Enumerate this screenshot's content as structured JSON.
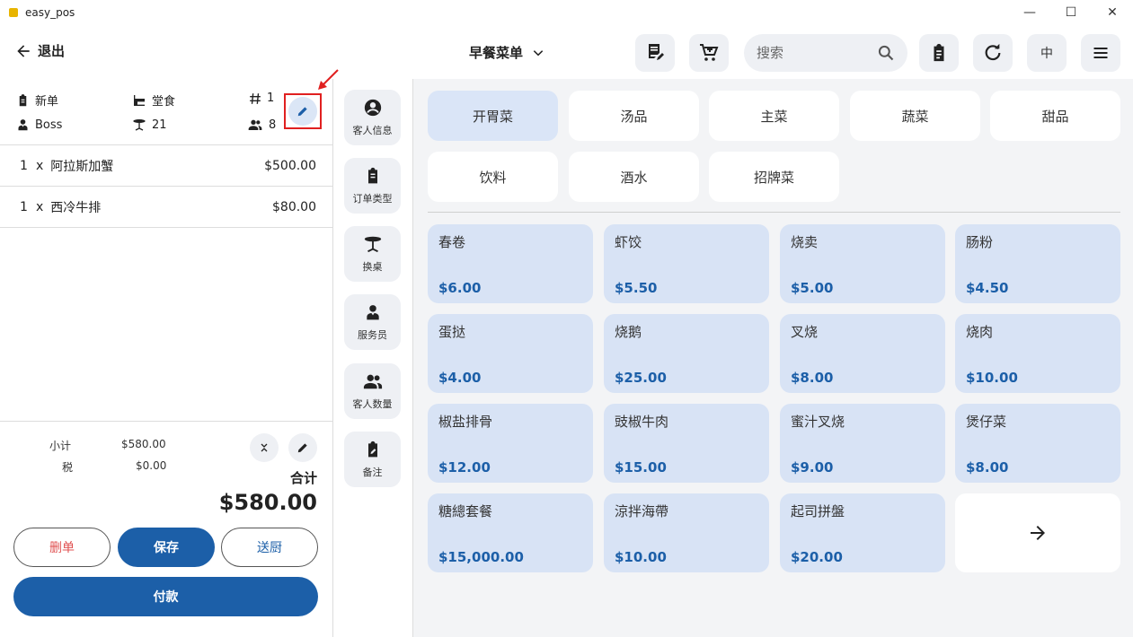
{
  "window": {
    "title": "easy_pos",
    "minimize": "—",
    "maximize": "☐",
    "close": "✕"
  },
  "header": {
    "back_label": "退出",
    "menu_name": "早餐菜单",
    "search_placeholder": "搜索",
    "language": "中"
  },
  "order": {
    "info": {
      "status": "新单",
      "dining_type": "堂食",
      "order_number": "1",
      "waiter": "Boss",
      "table": "21",
      "guests": "8"
    },
    "items": [
      {
        "qty": "1",
        "x": "x",
        "name": "阿拉斯加蟹",
        "price": "$500.00"
      },
      {
        "qty": "1",
        "x": "x",
        "name": "西冷牛排",
        "price": "$80.00"
      }
    ],
    "subtotal_label": "小计",
    "subtotal_value": "$580.00",
    "tax_label": "税",
    "tax_value": "$0.00",
    "total_label": "合计",
    "total_value": "$580.00",
    "buttons": {
      "delete": "删单",
      "save": "保存",
      "kitchen": "送厨",
      "pay": "付款"
    }
  },
  "side_actions": [
    {
      "label": "客人信息",
      "icon": "account-circle-icon"
    },
    {
      "label": "订单类型",
      "icon": "clipboard-icon"
    },
    {
      "label": "换桌",
      "icon": "table-icon"
    },
    {
      "label": "服务员",
      "icon": "waiter-icon"
    },
    {
      "label": "客人数量",
      "icon": "people-icon"
    },
    {
      "label": "备注",
      "icon": "note-edit-icon"
    }
  ],
  "categories": [
    "开胃菜",
    "汤品",
    "主菜",
    "蔬菜",
    "甜品",
    "饮料",
    "酒水",
    "招牌菜"
  ],
  "active_category": "开胃菜",
  "products": [
    {
      "name": "春卷",
      "price": "$6.00"
    },
    {
      "name": "虾饺",
      "price": "$5.50"
    },
    {
      "name": "烧卖",
      "price": "$5.00"
    },
    {
      "name": "肠粉",
      "price": "$4.50"
    },
    {
      "name": "蛋挞",
      "price": "$4.00"
    },
    {
      "name": "烧鹅",
      "price": "$25.00"
    },
    {
      "name": "叉烧",
      "price": "$8.00"
    },
    {
      "name": "烧肉",
      "price": "$10.00"
    },
    {
      "name": "椒盐排骨",
      "price": "$12.00"
    },
    {
      "name": "豉椒牛肉",
      "price": "$15.00"
    },
    {
      "name": "蜜汁叉烧",
      "price": "$9.00"
    },
    {
      "name": "煲仔菜",
      "price": "$8.00"
    },
    {
      "name": "糖總套餐",
      "price": "$15,000.00"
    },
    {
      "name": "涼拌海帶",
      "price": "$10.00"
    },
    {
      "name": "起司拼盤",
      "price": "$20.00"
    }
  ],
  "colors": {
    "primary": "#1c5fa8",
    "product_bg": "#d8e3f5",
    "active_cat": "#dae5f7",
    "delete_text": "#e05050",
    "highlight": "#e02020"
  }
}
